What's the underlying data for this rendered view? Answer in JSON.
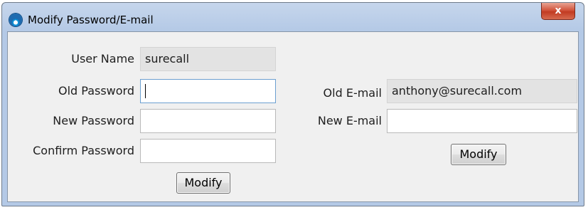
{
  "window": {
    "title": "Modify Password/E-mail",
    "close_label": "x"
  },
  "password_panel": {
    "user_name": {
      "label": "User Name",
      "value": "surecall"
    },
    "old_password": {
      "label": "Old Password",
      "value": ""
    },
    "new_password": {
      "label": "New Password",
      "value": ""
    },
    "confirm_password": {
      "label": "Confirm Password",
      "value": ""
    },
    "modify_label": "Modify"
  },
  "email_panel": {
    "old_email": {
      "label": "Old E-mail",
      "value": "anthony@surecall.com"
    },
    "new_email": {
      "label": "New E-mail",
      "value": ""
    },
    "modify_label": "Modify"
  },
  "colors": {
    "title_bar": "#b4c9e6",
    "close_button": "#c13b22",
    "client_background": "#f0f0f0",
    "readonly_field": "#e3e3e3"
  },
  "icons": {
    "app": "app-icon",
    "close": "close-icon"
  }
}
